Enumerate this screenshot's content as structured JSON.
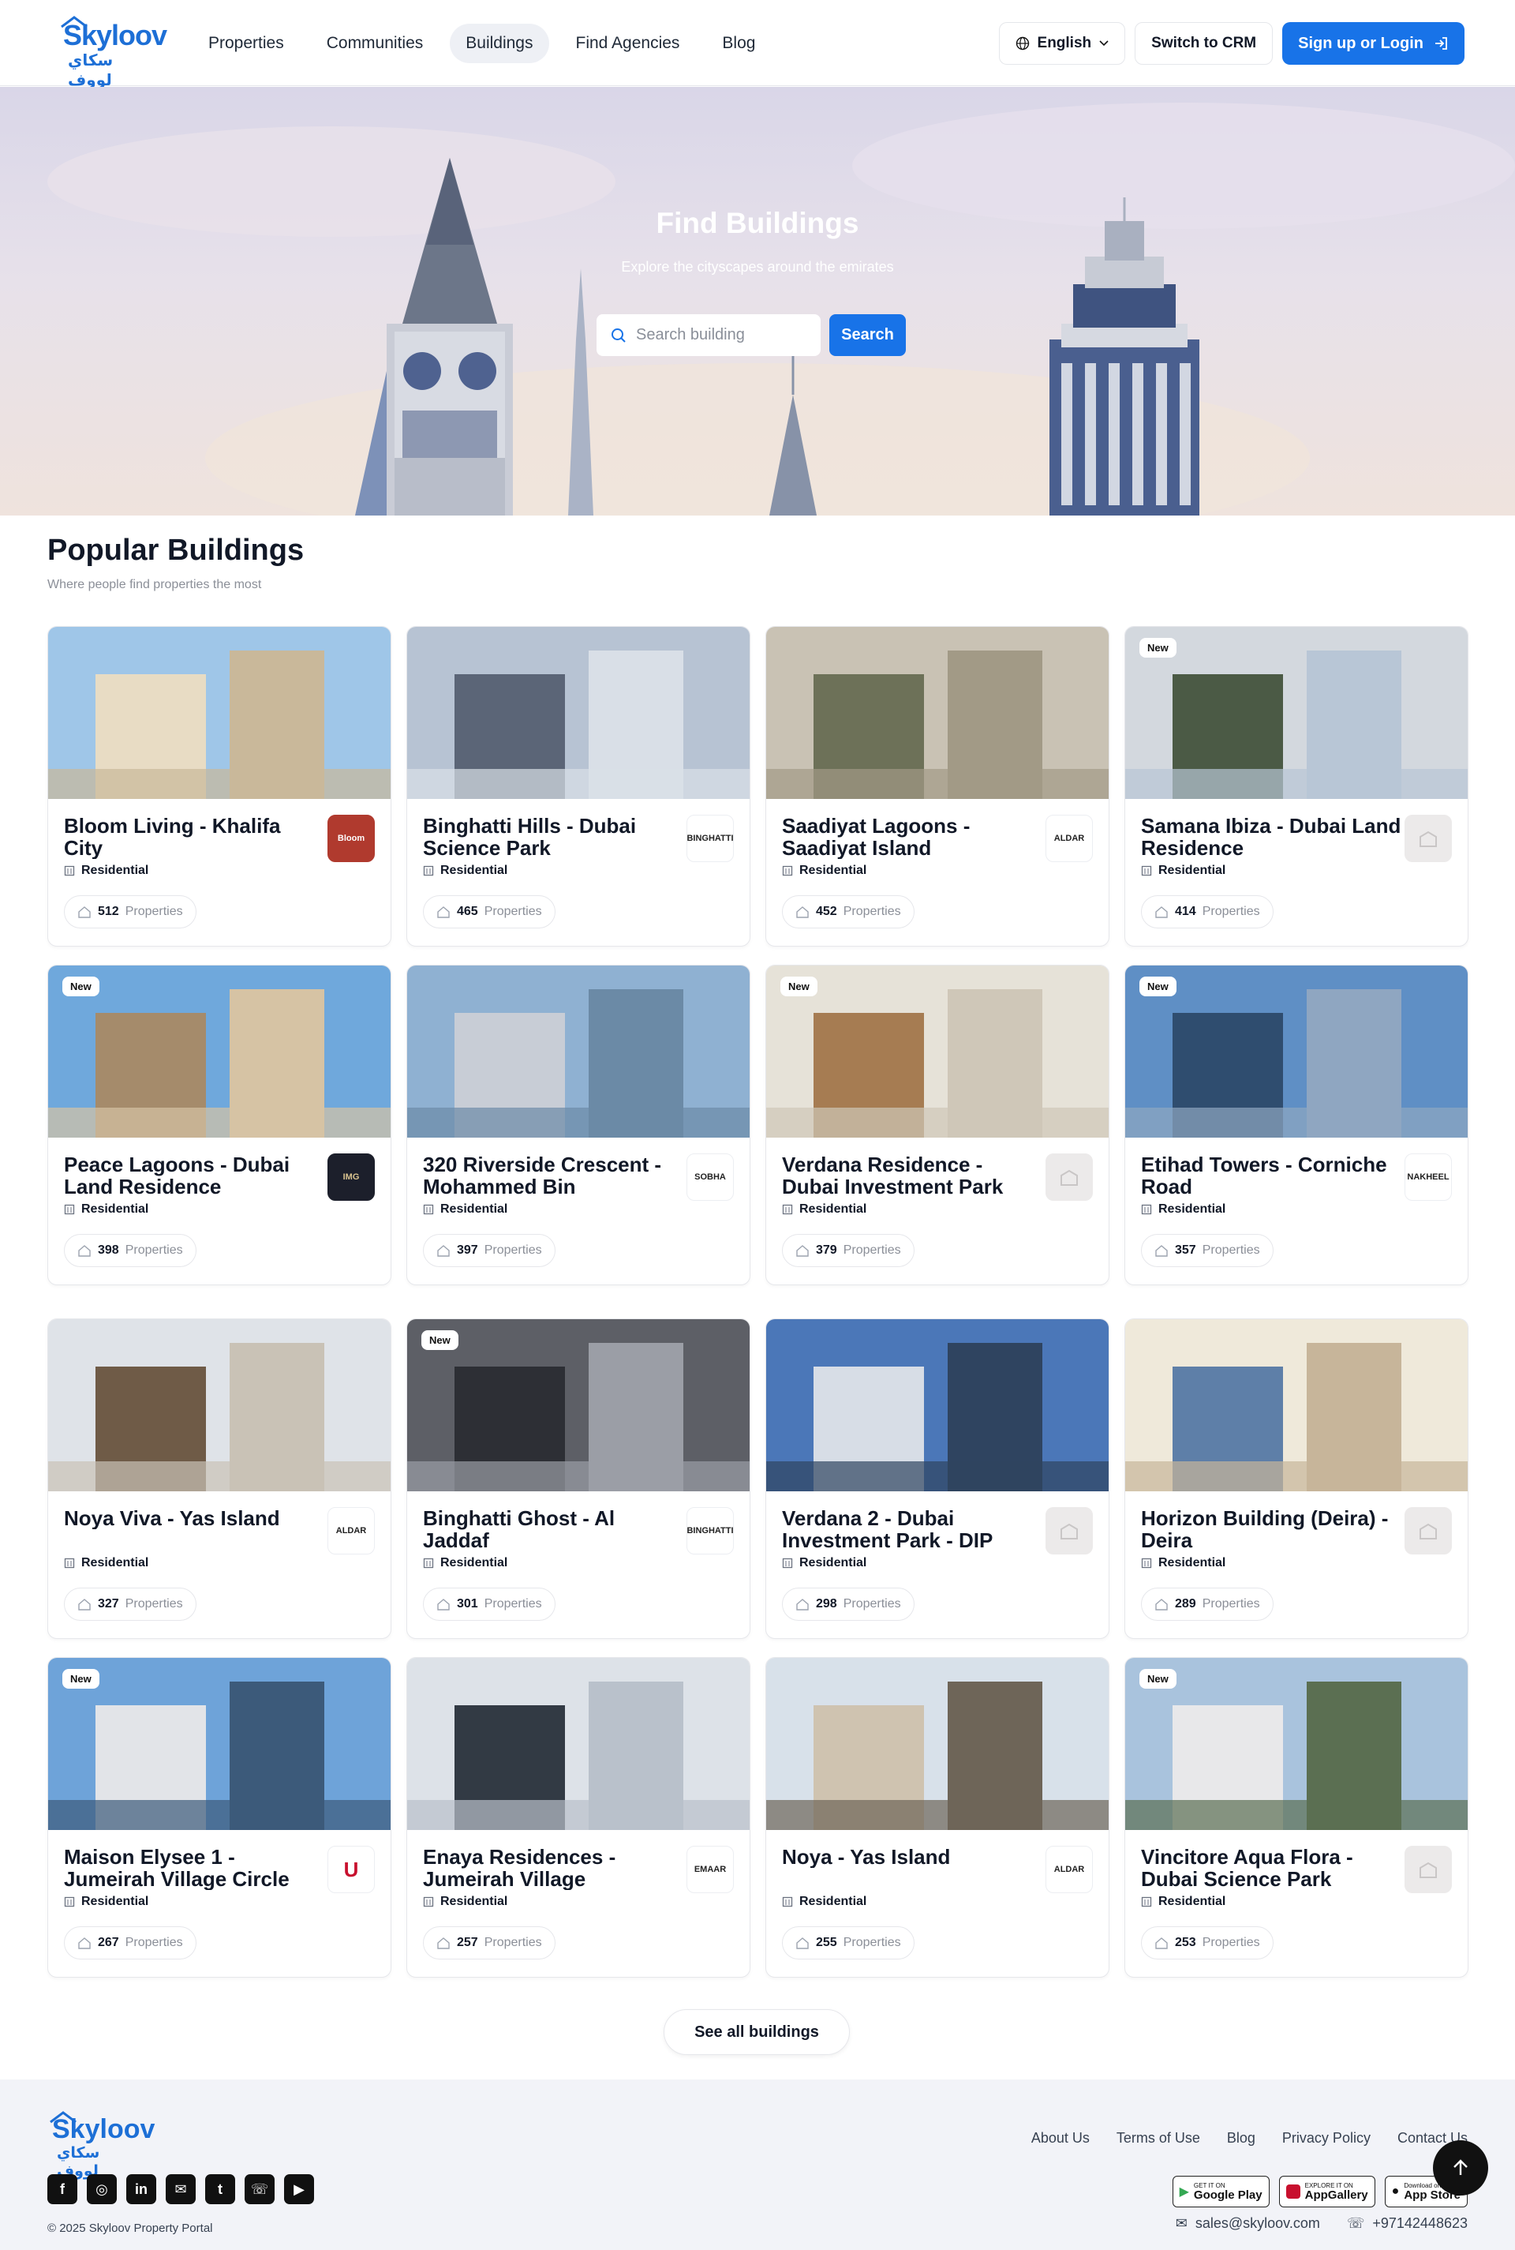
{
  "header": {
    "logo_en": "Skyloov",
    "logo_ar": "سكاي لووف",
    "nav": [
      "Properties",
      "Communities",
      "Buildings",
      "Find Agencies",
      "Blog"
    ],
    "active_nav": "Buildings",
    "language": "English",
    "crm_label": "Switch to CRM",
    "login_label": "Sign up or Login"
  },
  "hero": {
    "title": "Find Buildings",
    "subtitle": "Explore the cityscapes around the emirates",
    "search_placeholder": "Search building",
    "search_button": "Search"
  },
  "section": {
    "title": "Popular Buildings",
    "subtitle": "Where people find properties the most"
  },
  "buildings": [
    {
      "title": "Bloom Living - Khalifa City",
      "type": "Residential",
      "count": "512",
      "count_label": "Properties",
      "is_new": false,
      "logo": "Bloom"
    },
    {
      "title": "Binghatti Hills - Dubai Science Park",
      "type": "Residential",
      "count": "465",
      "count_label": "Properties",
      "is_new": false,
      "logo": "BINGHATTI"
    },
    {
      "title": "Saadiyat Lagoons - Saadiyat Island",
      "type": "Residential",
      "count": "452",
      "count_label": "Properties",
      "is_new": false,
      "logo": "ALDAR"
    },
    {
      "title": "Samana Ibiza - Dubai Land Residence",
      "type": "Residential",
      "count": "414",
      "count_label": "Properties",
      "is_new": true,
      "logo": ""
    },
    {
      "title": "Peace Lagoons - Dubai Land Residence",
      "type": "Residential",
      "count": "398",
      "count_label": "Properties",
      "is_new": true,
      "logo": "IMG"
    },
    {
      "title": "320 Riverside Crescent - Mohammed Bin",
      "type": "Residential",
      "count": "397",
      "count_label": "Properties",
      "is_new": false,
      "logo": "SOBHA"
    },
    {
      "title": "Verdana Residence - Dubai Investment Park",
      "type": "Residential",
      "count": "379",
      "count_label": "Properties",
      "is_new": true,
      "logo": ""
    },
    {
      "title": "Etihad Towers - Corniche Road",
      "type": "Residential",
      "count": "357",
      "count_label": "Properties",
      "is_new": true,
      "logo": "NAKHEEL"
    },
    {
      "title": "Noya Viva - Yas Island",
      "type": "Residential",
      "count": "327",
      "count_label": "Properties",
      "is_new": false,
      "logo": "ALDAR"
    },
    {
      "title": "Binghatti Ghost - Al Jaddaf",
      "type": "Residential",
      "count": "301",
      "count_label": "Properties",
      "is_new": true,
      "logo": "BINGHATTI"
    },
    {
      "title": "Verdana 2 - Dubai Investment Park - DIP",
      "type": "Residential",
      "count": "298",
      "count_label": "Properties",
      "is_new": false,
      "logo": ""
    },
    {
      "title": "Horizon Building (Deira) - Deira",
      "type": "Residential",
      "count": "289",
      "count_label": "Properties",
      "is_new": false,
      "logo": ""
    },
    {
      "title": "Maison Elysee 1 - Jumeirah Village Circle",
      "type": "Residential",
      "count": "267",
      "count_label": "Properties",
      "is_new": true,
      "logo": "U"
    },
    {
      "title": "Enaya Residences - Jumeirah Village",
      "type": "Residential",
      "count": "257",
      "count_label": "Properties",
      "is_new": false,
      "logo": "EMAAR"
    },
    {
      "title": "Noya - Yas Island",
      "type": "Residential",
      "count": "255",
      "count_label": "Properties",
      "is_new": false,
      "logo": "ALDAR"
    },
    {
      "title": "Vincitore Aqua Flora - Dubai Science Park",
      "type": "Residential",
      "count": "253",
      "count_label": "Properties",
      "is_new": true,
      "logo": ""
    }
  ],
  "new_badge": "New",
  "see_all": "See all buildings",
  "footer": {
    "links": [
      "About Us",
      "Terms of Use",
      "Blog",
      "Privacy Policy",
      "Contact Us"
    ],
    "copyright": "© 2025 Skyloov Property Portal",
    "email": "sales@skyloov.com",
    "phone": "+97142448623",
    "stores": [
      {
        "small": "GET IT ON",
        "big": "Google Play"
      },
      {
        "small": "EXPLORE IT ON",
        "big": "AppGallery"
      },
      {
        "small": "Download on the",
        "big": "App Store"
      }
    ],
    "socials": [
      "facebook-icon",
      "instagram-icon",
      "linkedin-icon",
      "email-icon",
      "twitter-icon",
      "whatsapp-icon",
      "youtube-icon"
    ]
  },
  "colors": {
    "primary": "#1873e8",
    "logo": "#1d6fd6",
    "footer_bg": "#f2f3f8"
  }
}
